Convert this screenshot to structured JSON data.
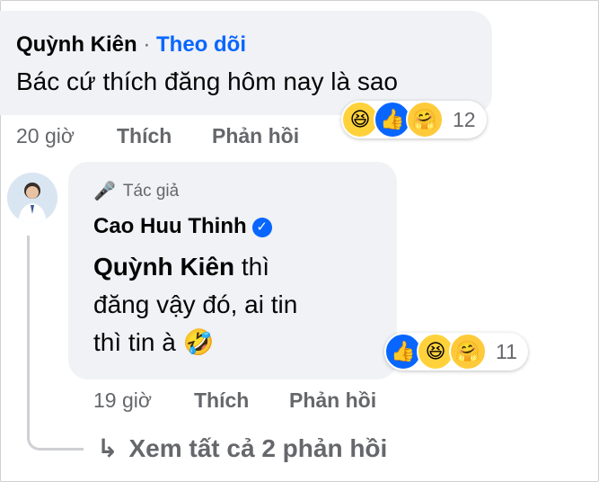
{
  "comment1": {
    "author": "Quỳnh Kiên",
    "separator": "·",
    "follow": "Theo dõi",
    "text": "Bác cứ thích đăng hôm nay là sao",
    "time": "20 giờ",
    "like": "Thích",
    "reply": "Phản hồi",
    "reaction_count": "12",
    "reactions": [
      "haha-icon",
      "like-icon",
      "care-icon"
    ]
  },
  "reply1": {
    "badge": "Tác giả",
    "author": "Cao Huu Thinh",
    "mention": "Quỳnh Kiên",
    "text_line1": " thì",
    "text_line2": "đăng vậy đó, ai tin",
    "text_line3": "thì tin à",
    "emoji": "🤣",
    "time": "19 giờ",
    "like": "Thích",
    "reply": "Phản hồi",
    "reaction_count": "11",
    "reactions": [
      "like-icon",
      "haha-icon",
      "care-icon"
    ]
  },
  "see_all": "Xem tất cả 2 phản hồi",
  "colors": {
    "link": "#0866ff",
    "meta": "#65676b",
    "bubble": "#f0f2f5"
  }
}
